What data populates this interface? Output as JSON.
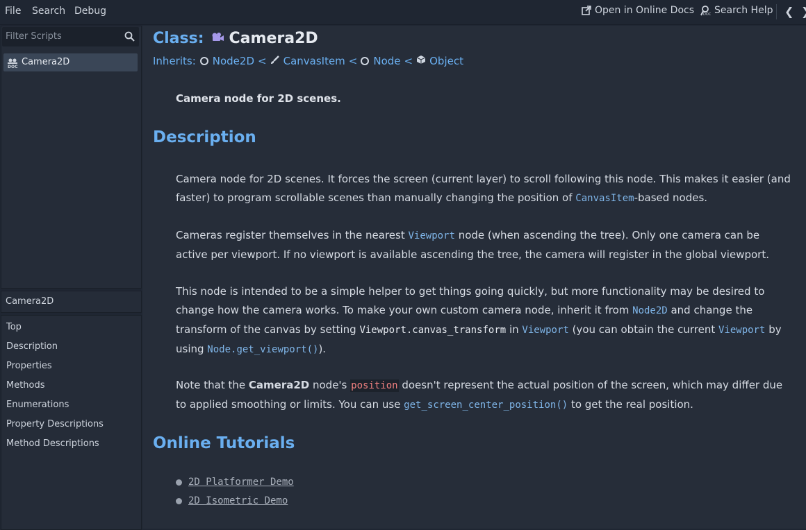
{
  "menu": {
    "file": "File",
    "search": "Search",
    "debug": "Debug"
  },
  "toolbar": {
    "online_docs": "Open in Online Docs",
    "search_help": "Search Help",
    "prev": "❮",
    "next": "❯"
  },
  "sidebar": {
    "filter_placeholder": "Filter Scripts",
    "scripts": [
      {
        "label": "Camera2D"
      }
    ],
    "current_name": "Camera2D",
    "sections": [
      "Top",
      "Description",
      "Properties",
      "Methods",
      "Enumerations",
      "Property Descriptions",
      "Method Descriptions"
    ]
  },
  "doc": {
    "class_label": "Class:",
    "class_name": "Camera2D",
    "inherits_label": "Inherits:",
    "inherits": [
      "Node2D",
      "CanvasItem",
      "Node",
      "Object"
    ],
    "lt": "<",
    "brief": "Camera node for 2D scenes.",
    "description_heading": "Description",
    "p1_a": "Camera node for 2D scenes. It forces the screen (current layer) to scroll following this node. This makes it easier (and faster) to program scrollable scenes than manually changing the position of ",
    "p1_code": "CanvasItem",
    "p1_b": "-based nodes.",
    "p2_a": "Cameras register themselves in the nearest ",
    "p2_code": "Viewport",
    "p2_b": " node (when ascending the tree). Only one camera can be active per viewport. If no viewport is available ascending the tree, the camera will register in the global viewport.",
    "p3_a": "This node is intended to be a simple helper to get things going quickly, but more functionality may be desired to change how the camera works. To make your own custom camera node, inherit it from ",
    "p3_code1": "Node2D",
    "p3_b": " and change the transform of the canvas by setting ",
    "p3_code2": "Viewport.canvas_transform",
    "p3_c": " in ",
    "p3_code3": "Viewport",
    "p3_d": " (you can obtain the current ",
    "p3_code4": "Viewport",
    "p3_e": " by using ",
    "p3_code5": "Node.get_viewport()",
    "p3_f": ").",
    "p4_a": "Note that the ",
    "p4_bold": "Camera2D",
    "p4_b": " node's ",
    "p4_code": "position",
    "p4_c": " doesn't represent the actual position of the screen, which may differ due to applied smoothing or limits. You can use ",
    "p4_code2": "get_screen_center_position()",
    "p4_d": " to get the real position.",
    "tutorials_heading": "Online Tutorials",
    "tutorials": [
      "2D Platformer Demo",
      "2D Isometric Demo"
    ]
  }
}
